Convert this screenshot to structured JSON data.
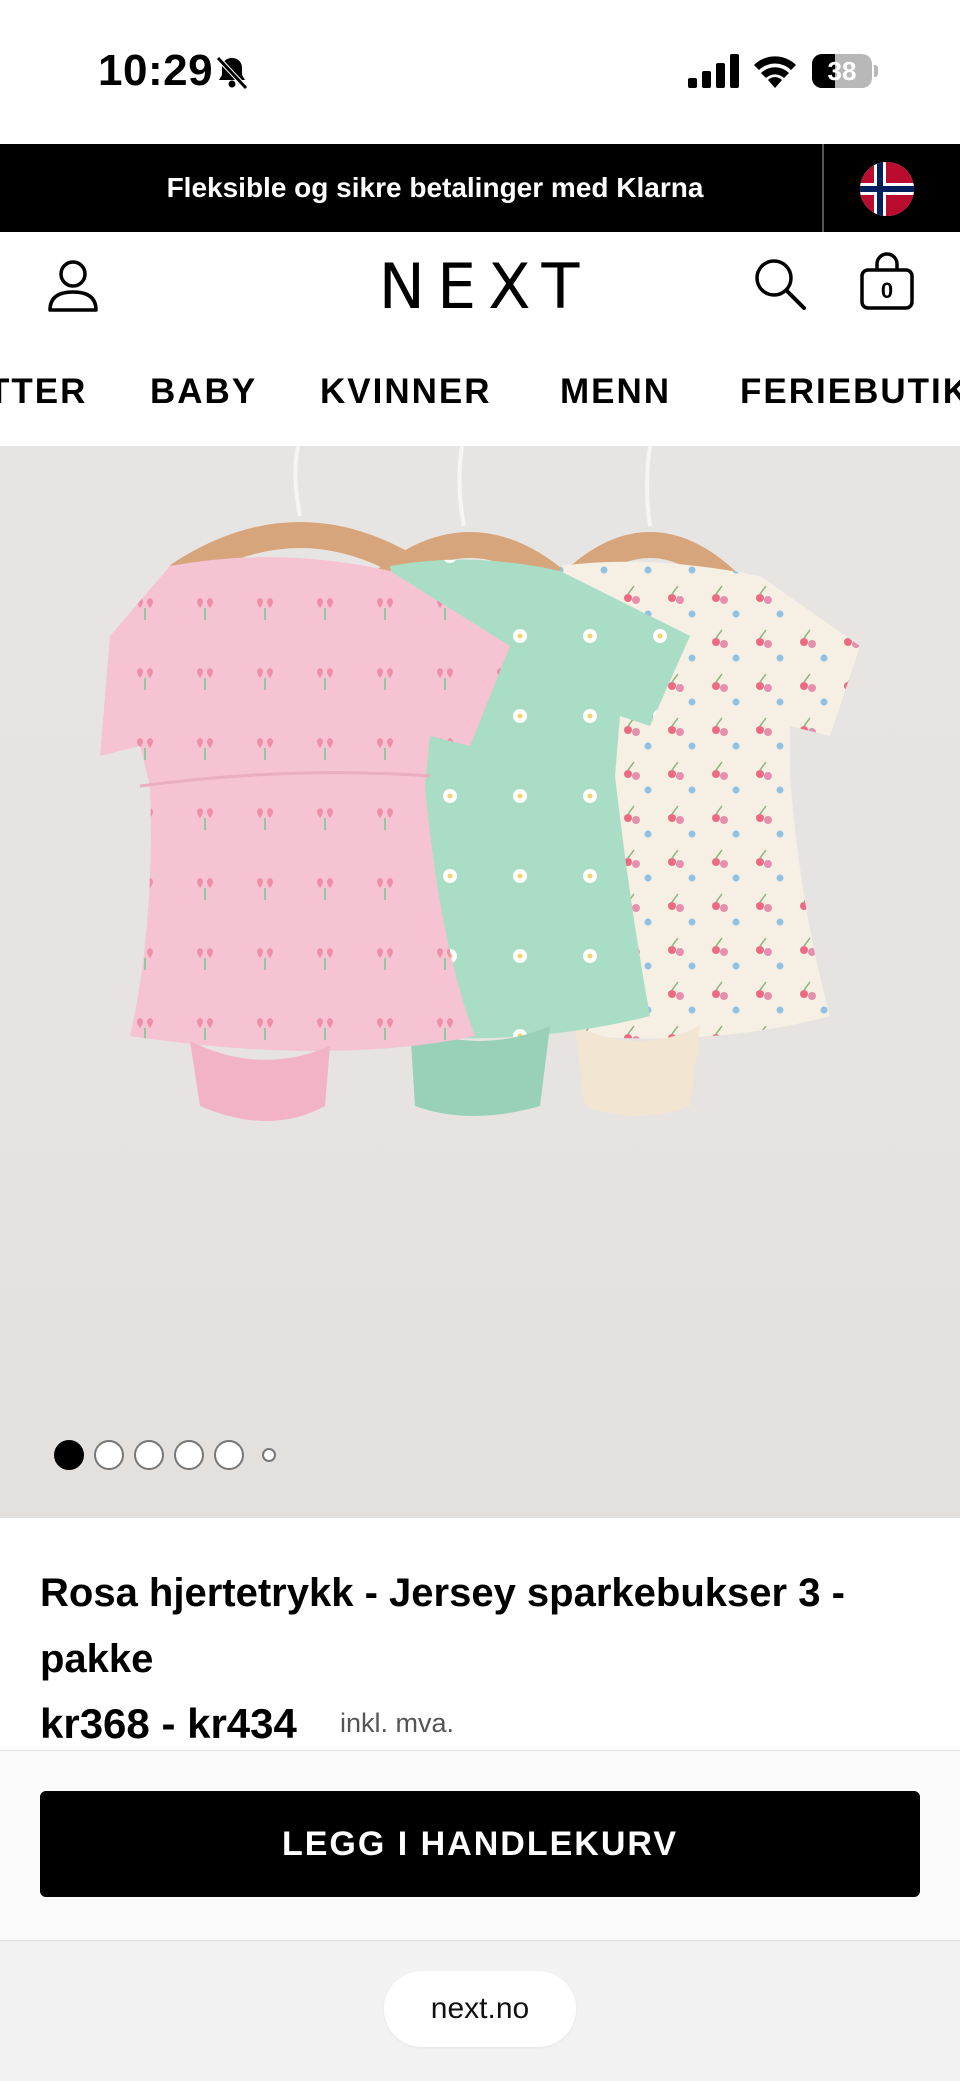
{
  "status_bar": {
    "time": "10:29",
    "battery": "38",
    "battery_level": 0.38
  },
  "promo_banner": {
    "text": "Fleksible og sikre betalinger med Klarna",
    "flag": "norway-flag-icon"
  },
  "header": {
    "logo": "NEXT",
    "bag_count": "0"
  },
  "nav": {
    "items": [
      "TTER",
      "BABY",
      "KVINNER",
      "MENN",
      "FERIEBUTIK"
    ]
  },
  "gallery": {
    "image_alt": "pink-mint-cream-baby-dresses-on-hangers",
    "dots_total": 6,
    "active_index": 0
  },
  "product": {
    "title": "Rosa hjertetrykk - Jersey sparkebukser 3 - pakke",
    "price": "kr368 - kr434",
    "tax_note": "inkl. mva."
  },
  "cart": {
    "button_label": "LEGG I HANDLEKURV"
  },
  "browser": {
    "url": "next.no"
  },
  "colors": {
    "banner_bg": "#000000",
    "button_bg": "#000000",
    "dress_pink": "#f6c3d3",
    "dress_mint": "#a9ddc6",
    "dress_cream": "#f6efe4"
  }
}
